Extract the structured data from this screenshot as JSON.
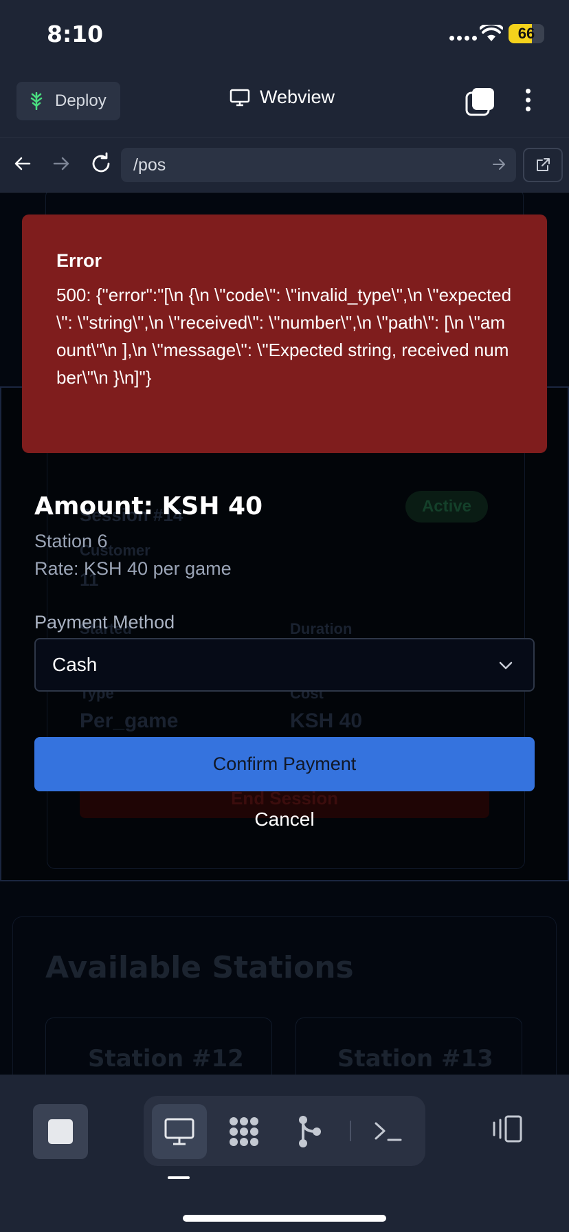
{
  "status_bar": {
    "time": "8:10",
    "battery": "66",
    "battery_level": 0.66
  },
  "header": {
    "deploy_label": "Deploy",
    "title": "Webview"
  },
  "urlbar": {
    "url": "/pos"
  },
  "background": {
    "session_title": "Session #14",
    "status_badge": "Active",
    "customer_label": "Customer",
    "customer_value": "11",
    "started_label": "Started",
    "duration_label": "Duration",
    "type_label": "Type",
    "type_value": "Per_game",
    "cost_label": "Cost",
    "cost_value": "KSH 40",
    "end_button": "End Session",
    "stations_title": "Available Stations",
    "stations": [
      "Station #12",
      "Station #13"
    ]
  },
  "modal": {
    "error_title": "Error",
    "error_message": "500: {\"error\":\"[\\n {\\n \\\"code\\\": \\\"invalid_type\\\",\\n \\\"expected\\\": \\\"string\\\",\\n \\\"received\\\": \\\"number\\\",\\n \\\"path\\\": [\\n \\\"amount\\\"\\n ],\\n \\\"message\\\": \\\"Expected string, received number\\\"\\n }\\n]\"}",
    "amount_title": "Amount: KSH 40",
    "station": "Station 6",
    "rate": "Rate: KSH 40 per game",
    "payment_method_label": "Payment Method",
    "payment_method_value": "Cash",
    "confirm_label": "Confirm Payment",
    "cancel_label": "Cancel"
  },
  "colors": {
    "accent": "#3573de",
    "error_bg": "#7f1d1d",
    "chrome": "#1e2535"
  }
}
